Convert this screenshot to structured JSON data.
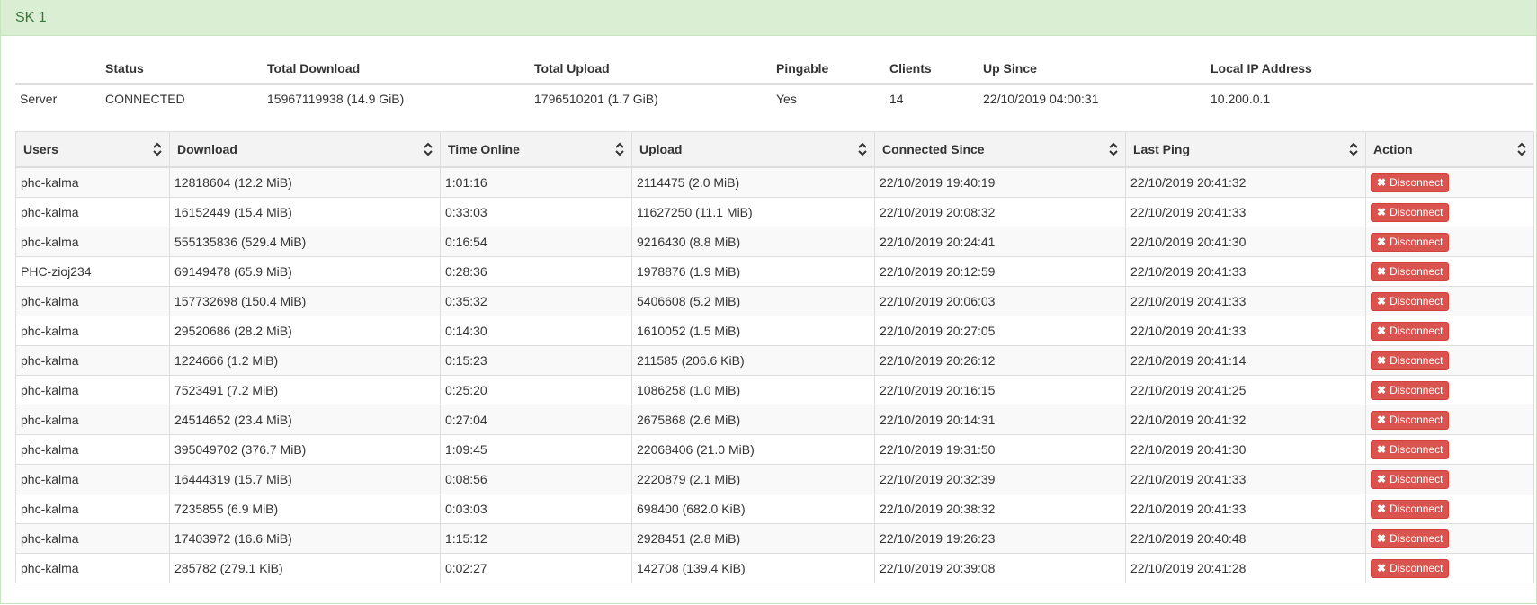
{
  "panel": {
    "title": "SK 1"
  },
  "server": {
    "headers": [
      "",
      "Status",
      "Total Download",
      "Total Upload",
      "Pingable",
      "Clients",
      "Up Since",
      "Local IP Address"
    ],
    "row": [
      "Server",
      "CONNECTED",
      "15967119938 (14.9 GiB)",
      "1796510201 (1.7 GiB)",
      "Yes",
      "14",
      "22/10/2019 04:00:31",
      "10.200.0.1"
    ]
  },
  "users_table": {
    "headers": [
      "Users",
      "Download",
      "Time Online",
      "Upload",
      "Connected Since",
      "Last Ping",
      "Action"
    ],
    "action_label": "Disconnect",
    "icons": {
      "sort": "sort-icon",
      "remove": "times-icon"
    },
    "colors": {
      "danger": "#d9534f",
      "heading_bg": "#d9eed2",
      "heading_text": "#3c763d"
    },
    "rows": [
      [
        "phc-kalma",
        "12818604 (12.2 MiB)",
        "1:01:16",
        "2114475 (2.0 MiB)",
        "22/10/2019 19:40:19",
        "22/10/2019 20:41:32"
      ],
      [
        "phc-kalma",
        "16152449 (15.4 MiB)",
        "0:33:03",
        "11627250 (11.1 MiB)",
        "22/10/2019 20:08:32",
        "22/10/2019 20:41:33"
      ],
      [
        "phc-kalma",
        "555135836 (529.4 MiB)",
        "0:16:54",
        "9216430 (8.8 MiB)",
        "22/10/2019 20:24:41",
        "22/10/2019 20:41:30"
      ],
      [
        "PHC-zioj234",
        "69149478 (65.9 MiB)",
        "0:28:36",
        "1978876 (1.9 MiB)",
        "22/10/2019 20:12:59",
        "22/10/2019 20:41:33"
      ],
      [
        "phc-kalma",
        "157732698 (150.4 MiB)",
        "0:35:32",
        "5406608 (5.2 MiB)",
        "22/10/2019 20:06:03",
        "22/10/2019 20:41:33"
      ],
      [
        "phc-kalma",
        "29520686 (28.2 MiB)",
        "0:14:30",
        "1610052 (1.5 MiB)",
        "22/10/2019 20:27:05",
        "22/10/2019 20:41:33"
      ],
      [
        "phc-kalma",
        "1224666 (1.2 MiB)",
        "0:15:23",
        "211585 (206.6 KiB)",
        "22/10/2019 20:26:12",
        "22/10/2019 20:41:14"
      ],
      [
        "phc-kalma",
        "7523491 (7.2 MiB)",
        "0:25:20",
        "1086258 (1.0 MiB)",
        "22/10/2019 20:16:15",
        "22/10/2019 20:41:25"
      ],
      [
        "phc-kalma",
        "24514652 (23.4 MiB)",
        "0:27:04",
        "2675868 (2.6 MiB)",
        "22/10/2019 20:14:31",
        "22/10/2019 20:41:32"
      ],
      [
        "phc-kalma",
        "395049702 (376.7 MiB)",
        "1:09:45",
        "22068406 (21.0 MiB)",
        "22/10/2019 19:31:50",
        "22/10/2019 20:41:30"
      ],
      [
        "phc-kalma",
        "16444319 (15.7 MiB)",
        "0:08:56",
        "2220879 (2.1 MiB)",
        "22/10/2019 20:32:39",
        "22/10/2019 20:41:33"
      ],
      [
        "phc-kalma",
        "7235855 (6.9 MiB)",
        "0:03:03",
        "698400 (682.0 KiB)",
        "22/10/2019 20:38:32",
        "22/10/2019 20:41:33"
      ],
      [
        "phc-kalma",
        "17403972 (16.6 MiB)",
        "1:15:12",
        "2928451 (2.8 MiB)",
        "22/10/2019 19:26:23",
        "22/10/2019 20:40:48"
      ],
      [
        "phc-kalma",
        "285782 (279.1 KiB)",
        "0:02:27",
        "142708 (139.4 KiB)",
        "22/10/2019 20:39:08",
        "22/10/2019 20:41:28"
      ]
    ]
  }
}
